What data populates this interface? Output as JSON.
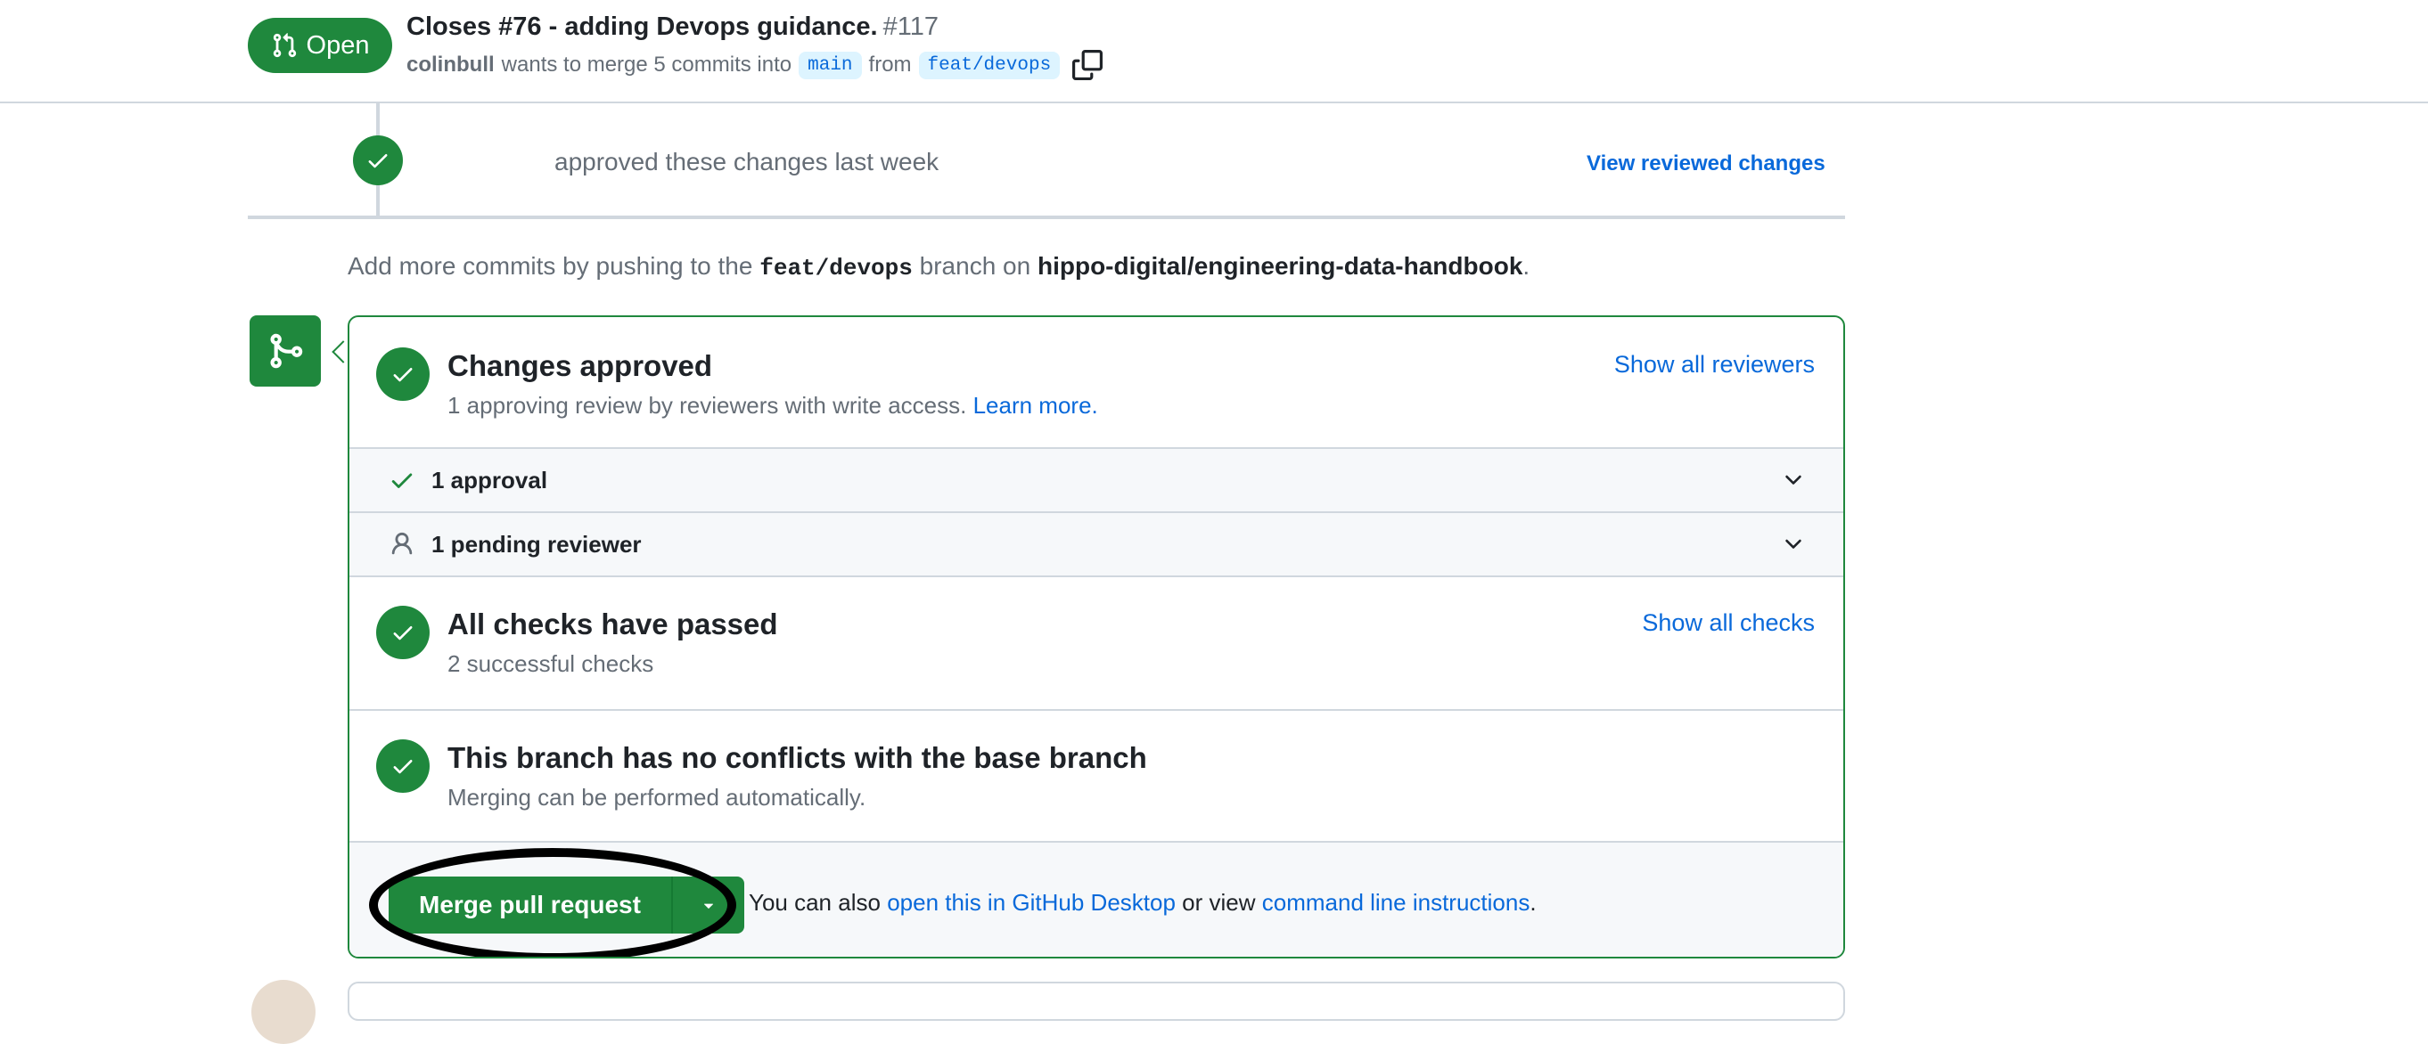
{
  "header": {
    "state_label": "Open",
    "title": "Closes #76 - adding Devops guidance.",
    "number": "#117",
    "author": "colinbull",
    "merge_text": "wants to merge 5 commits into",
    "base_branch": "main",
    "from_text": "from",
    "head_branch": "feat/devops"
  },
  "timeline": {
    "review_text": "approved these changes last week",
    "view_reviewed_label": "View reviewed changes"
  },
  "push_hint": {
    "prefix": "Add more commits by pushing to the",
    "branch": "feat/devops",
    "middle": "branch on",
    "repo": "hippo-digital/engineering-data-handbook",
    "suffix": "."
  },
  "merge_box": {
    "approved": {
      "title": "Changes approved",
      "subtitle": "1 approving review by reviewers with write access.",
      "learn_more": "Learn more.",
      "link": "Show all reviewers"
    },
    "approvals_row": "1 approval",
    "pending_row": "1 pending reviewer",
    "checks": {
      "title": "All checks have passed",
      "subtitle": "2 successful checks",
      "link": "Show all checks"
    },
    "conflicts": {
      "title": "This branch has no conflicts with the base branch",
      "subtitle": "Merging can be performed automatically."
    },
    "footer": {
      "merge_button": "Merge pull request",
      "alt_prefix": "You can also",
      "desktop_link": "open this in GitHub Desktop",
      "alt_middle": "or view",
      "cli_link": "command line instructions",
      "alt_suffix": "."
    }
  },
  "colors": {
    "success": "#1f883d",
    "link": "#0969da",
    "muted": "#656d76",
    "border": "#d0d7de",
    "annotation": "#000000"
  }
}
